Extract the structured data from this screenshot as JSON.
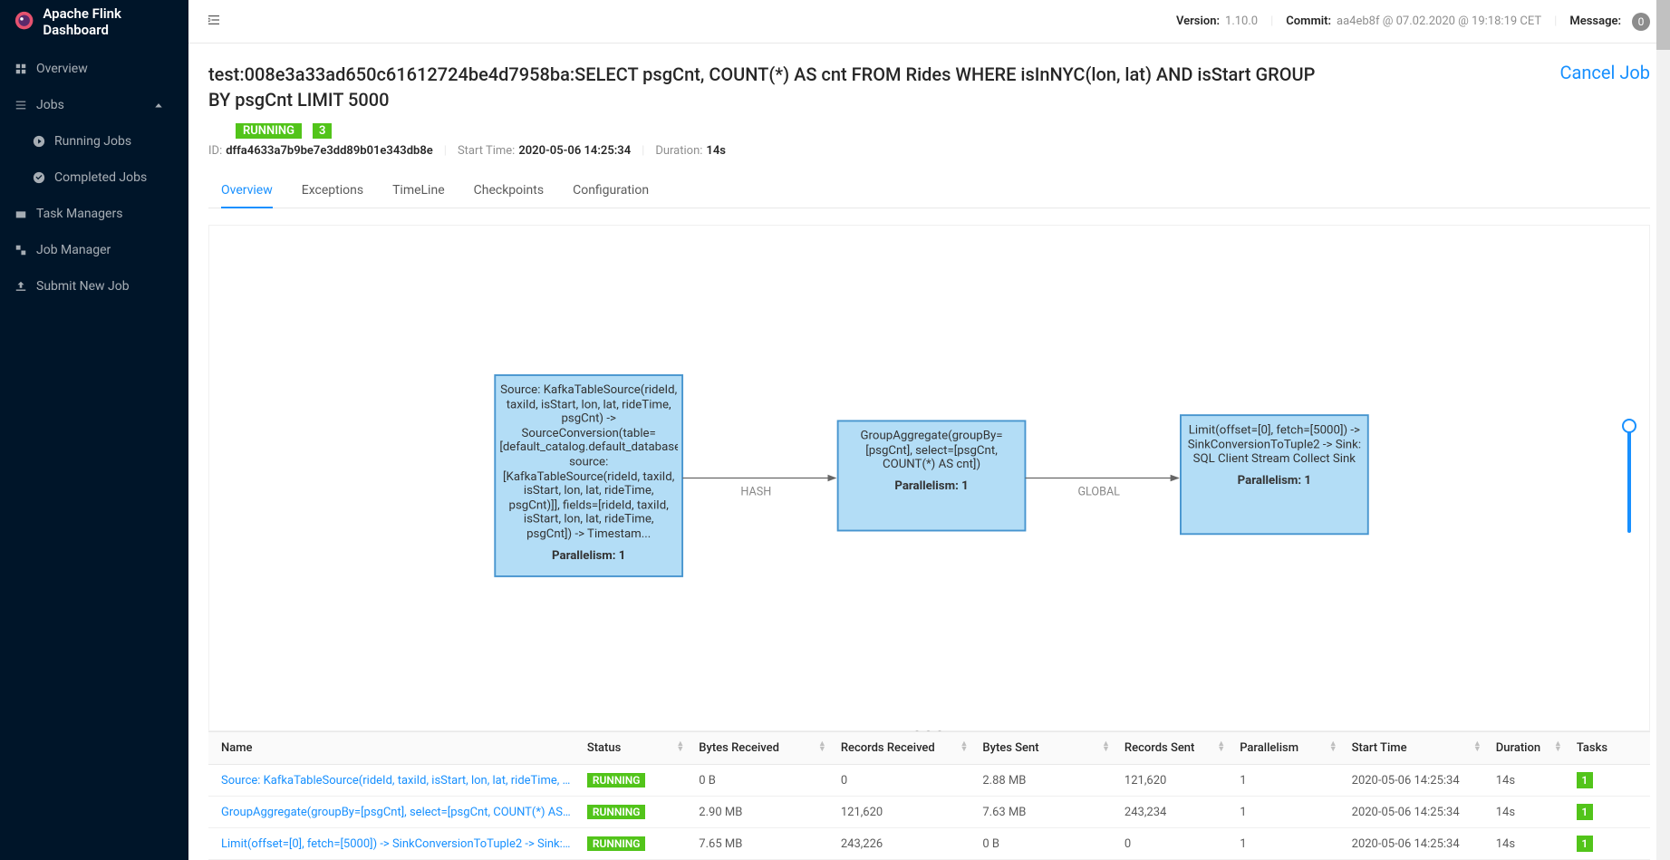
{
  "app": {
    "title": "Apache Flink Dashboard"
  },
  "topbar": {
    "version_label": "Version:",
    "version": "1.10.0",
    "commit_label": "Commit:",
    "commit": "aa4eb8f @ 07.02.2020 @ 19:18:19 CET",
    "message_label": "Message:",
    "message_count": "0"
  },
  "sidebar": {
    "overview": "Overview",
    "jobs": "Jobs",
    "running_jobs": "Running Jobs",
    "completed_jobs": "Completed Jobs",
    "task_managers": "Task Managers",
    "job_manager": "Job Manager",
    "submit_job": "Submit New Job"
  },
  "job": {
    "title": "test:008e3a33ad650c61612724be4d7958ba:SELECT psgCnt, COUNT(*) AS cnt FROM Rides WHERE isInNYC(lon, lat) AND isStart GROUP BY psgCnt LIMIT 5000",
    "cancel_label": "Cancel Job",
    "status": "RUNNING",
    "task_count": "3",
    "id_label": "ID:",
    "id": "dffa4633a7b9be7e3dd89b01e343db8e",
    "start_label": "Start Time:",
    "start_time": "2020-05-06 14:25:34",
    "duration_label": "Duration:",
    "duration": "14s"
  },
  "tabs": {
    "overview": "Overview",
    "exceptions": "Exceptions",
    "timeline": "TimeLine",
    "checkpoints": "Checkpoints",
    "configuration": "Configuration"
  },
  "graph": {
    "node1": "Source: KafkaTableSource(rideId, taxiId, isStart, lon, lat, rideTime, psgCnt) -> SourceConversion(table=[default_catalog.default_database.Rides, source: [KafkaTableSource(rideId, taxiId, isStart, lon, lat, rideTime, psgCnt)]], fields=[rideId, taxiId, isStart, lon, lat, rideTime, psgCnt]) -> Timestam...",
    "node1_par": "Parallelism: 1",
    "edge1": "HASH",
    "node2": "GroupAggregate(groupBy=[psgCnt], select=[psgCnt, COUNT(*) AS cnt])",
    "node2_par": "Parallelism: 1",
    "edge2": "GLOBAL",
    "node3": "Limit(offset=[0], fetch=[5000]) -> SinkConversionToTuple2 -> Sink: SQL Client Stream Collect Sink",
    "node3_par": "Parallelism: 1"
  },
  "table": {
    "headers": {
      "name": "Name",
      "status": "Status",
      "bytes_received": "Bytes Received",
      "records_received": "Records Received",
      "bytes_sent": "Bytes Sent",
      "records_sent": "Records Sent",
      "parallelism": "Parallelism",
      "start_time": "Start Time",
      "duration": "Duration",
      "tasks": "Tasks"
    },
    "rows": [
      {
        "name": "Source: KafkaTableSource(rideId, taxiId, isStart, lon, lat, rideTime, p...",
        "status": "RUNNING",
        "bytes_received": "0 B",
        "records_received": "0",
        "bytes_sent": "2.88 MB",
        "records_sent": "121,620",
        "parallelism": "1",
        "start_time": "2020-05-06 14:25:34",
        "duration": "14s",
        "tasks": "1"
      },
      {
        "name": "GroupAggregate(groupBy=[psgCnt], select=[psgCnt, COUNT(*) AS c...",
        "status": "RUNNING",
        "bytes_received": "2.90 MB",
        "records_received": "121,620",
        "bytes_sent": "7.63 MB",
        "records_sent": "243,234",
        "parallelism": "1",
        "start_time": "2020-05-06 14:25:34",
        "duration": "14s",
        "tasks": "1"
      },
      {
        "name": "Limit(offset=[0], fetch=[5000]) -> SinkConversionToTuple2 -> Sink: S...",
        "status": "RUNNING",
        "bytes_received": "7.65 MB",
        "records_received": "243,226",
        "bytes_sent": "0 B",
        "records_sent": "0",
        "parallelism": "1",
        "start_time": "2020-05-06 14:25:34",
        "duration": "14s",
        "tasks": "1"
      }
    ]
  }
}
